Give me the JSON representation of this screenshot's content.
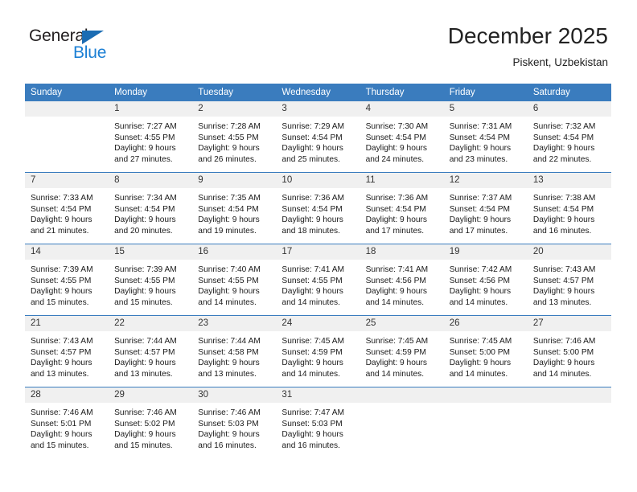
{
  "logo": {
    "primary_text": "General",
    "secondary_text": "Blue",
    "triangle_icon": "triangle-icon",
    "primary_color": "#231f20",
    "secondary_color": "#1b7fd4",
    "triangle_color": "#1b6cb3"
  },
  "header": {
    "title": "December 2025",
    "subtitle": "Piskent, Uzbekistan"
  },
  "theme": {
    "header_bg": "#3a7cbe",
    "header_text": "#ffffff",
    "daynum_bg": "#f0f0f0",
    "row_divider": "#3a7cbe",
    "body_bg": "#ffffff"
  },
  "calendar": {
    "columns": [
      "Sunday",
      "Monday",
      "Tuesday",
      "Wednesday",
      "Thursday",
      "Friday",
      "Saturday"
    ],
    "weeks": [
      [
        {
          "day": "",
          "empty": true,
          "sunrise": "",
          "sunset": "",
          "daylight_line1": "",
          "daylight_line2": ""
        },
        {
          "day": "1",
          "sunrise": "Sunrise: 7:27 AM",
          "sunset": "Sunset: 4:55 PM",
          "daylight_line1": "Daylight: 9 hours",
          "daylight_line2": "and 27 minutes."
        },
        {
          "day": "2",
          "sunrise": "Sunrise: 7:28 AM",
          "sunset": "Sunset: 4:55 PM",
          "daylight_line1": "Daylight: 9 hours",
          "daylight_line2": "and 26 minutes."
        },
        {
          "day": "3",
          "sunrise": "Sunrise: 7:29 AM",
          "sunset": "Sunset: 4:54 PM",
          "daylight_line1": "Daylight: 9 hours",
          "daylight_line2": "and 25 minutes."
        },
        {
          "day": "4",
          "sunrise": "Sunrise: 7:30 AM",
          "sunset": "Sunset: 4:54 PM",
          "daylight_line1": "Daylight: 9 hours",
          "daylight_line2": "and 24 minutes."
        },
        {
          "day": "5",
          "sunrise": "Sunrise: 7:31 AM",
          "sunset": "Sunset: 4:54 PM",
          "daylight_line1": "Daylight: 9 hours",
          "daylight_line2": "and 23 minutes."
        },
        {
          "day": "6",
          "sunrise": "Sunrise: 7:32 AM",
          "sunset": "Sunset: 4:54 PM",
          "daylight_line1": "Daylight: 9 hours",
          "daylight_line2": "and 22 minutes."
        }
      ],
      [
        {
          "day": "7",
          "sunrise": "Sunrise: 7:33 AM",
          "sunset": "Sunset: 4:54 PM",
          "daylight_line1": "Daylight: 9 hours",
          "daylight_line2": "and 21 minutes."
        },
        {
          "day": "8",
          "sunrise": "Sunrise: 7:34 AM",
          "sunset": "Sunset: 4:54 PM",
          "daylight_line1": "Daylight: 9 hours",
          "daylight_line2": "and 20 minutes."
        },
        {
          "day": "9",
          "sunrise": "Sunrise: 7:35 AM",
          "sunset": "Sunset: 4:54 PM",
          "daylight_line1": "Daylight: 9 hours",
          "daylight_line2": "and 19 minutes."
        },
        {
          "day": "10",
          "sunrise": "Sunrise: 7:36 AM",
          "sunset": "Sunset: 4:54 PM",
          "daylight_line1": "Daylight: 9 hours",
          "daylight_line2": "and 18 minutes."
        },
        {
          "day": "11",
          "sunrise": "Sunrise: 7:36 AM",
          "sunset": "Sunset: 4:54 PM",
          "daylight_line1": "Daylight: 9 hours",
          "daylight_line2": "and 17 minutes."
        },
        {
          "day": "12",
          "sunrise": "Sunrise: 7:37 AM",
          "sunset": "Sunset: 4:54 PM",
          "daylight_line1": "Daylight: 9 hours",
          "daylight_line2": "and 17 minutes."
        },
        {
          "day": "13",
          "sunrise": "Sunrise: 7:38 AM",
          "sunset": "Sunset: 4:54 PM",
          "daylight_line1": "Daylight: 9 hours",
          "daylight_line2": "and 16 minutes."
        }
      ],
      [
        {
          "day": "14",
          "sunrise": "Sunrise: 7:39 AM",
          "sunset": "Sunset: 4:55 PM",
          "daylight_line1": "Daylight: 9 hours",
          "daylight_line2": "and 15 minutes."
        },
        {
          "day": "15",
          "sunrise": "Sunrise: 7:39 AM",
          "sunset": "Sunset: 4:55 PM",
          "daylight_line1": "Daylight: 9 hours",
          "daylight_line2": "and 15 minutes."
        },
        {
          "day": "16",
          "sunrise": "Sunrise: 7:40 AM",
          "sunset": "Sunset: 4:55 PM",
          "daylight_line1": "Daylight: 9 hours",
          "daylight_line2": "and 14 minutes."
        },
        {
          "day": "17",
          "sunrise": "Sunrise: 7:41 AM",
          "sunset": "Sunset: 4:55 PM",
          "daylight_line1": "Daylight: 9 hours",
          "daylight_line2": "and 14 minutes."
        },
        {
          "day": "18",
          "sunrise": "Sunrise: 7:41 AM",
          "sunset": "Sunset: 4:56 PM",
          "daylight_line1": "Daylight: 9 hours",
          "daylight_line2": "and 14 minutes."
        },
        {
          "day": "19",
          "sunrise": "Sunrise: 7:42 AM",
          "sunset": "Sunset: 4:56 PM",
          "daylight_line1": "Daylight: 9 hours",
          "daylight_line2": "and 14 minutes."
        },
        {
          "day": "20",
          "sunrise": "Sunrise: 7:43 AM",
          "sunset": "Sunset: 4:57 PM",
          "daylight_line1": "Daylight: 9 hours",
          "daylight_line2": "and 13 minutes."
        }
      ],
      [
        {
          "day": "21",
          "sunrise": "Sunrise: 7:43 AM",
          "sunset": "Sunset: 4:57 PM",
          "daylight_line1": "Daylight: 9 hours",
          "daylight_line2": "and 13 minutes."
        },
        {
          "day": "22",
          "sunrise": "Sunrise: 7:44 AM",
          "sunset": "Sunset: 4:57 PM",
          "daylight_line1": "Daylight: 9 hours",
          "daylight_line2": "and 13 minutes."
        },
        {
          "day": "23",
          "sunrise": "Sunrise: 7:44 AM",
          "sunset": "Sunset: 4:58 PM",
          "daylight_line1": "Daylight: 9 hours",
          "daylight_line2": "and 13 minutes."
        },
        {
          "day": "24",
          "sunrise": "Sunrise: 7:45 AM",
          "sunset": "Sunset: 4:59 PM",
          "daylight_line1": "Daylight: 9 hours",
          "daylight_line2": "and 14 minutes."
        },
        {
          "day": "25",
          "sunrise": "Sunrise: 7:45 AM",
          "sunset": "Sunset: 4:59 PM",
          "daylight_line1": "Daylight: 9 hours",
          "daylight_line2": "and 14 minutes."
        },
        {
          "day": "26",
          "sunrise": "Sunrise: 7:45 AM",
          "sunset": "Sunset: 5:00 PM",
          "daylight_line1": "Daylight: 9 hours",
          "daylight_line2": "and 14 minutes."
        },
        {
          "day": "27",
          "sunrise": "Sunrise: 7:46 AM",
          "sunset": "Sunset: 5:00 PM",
          "daylight_line1": "Daylight: 9 hours",
          "daylight_line2": "and 14 minutes."
        }
      ],
      [
        {
          "day": "28",
          "sunrise": "Sunrise: 7:46 AM",
          "sunset": "Sunset: 5:01 PM",
          "daylight_line1": "Daylight: 9 hours",
          "daylight_line2": "and 15 minutes."
        },
        {
          "day": "29",
          "sunrise": "Sunrise: 7:46 AM",
          "sunset": "Sunset: 5:02 PM",
          "daylight_line1": "Daylight: 9 hours",
          "daylight_line2": "and 15 minutes."
        },
        {
          "day": "30",
          "sunrise": "Sunrise: 7:46 AM",
          "sunset": "Sunset: 5:03 PM",
          "daylight_line1": "Daylight: 9 hours",
          "daylight_line2": "and 16 minutes."
        },
        {
          "day": "31",
          "sunrise": "Sunrise: 7:47 AM",
          "sunset": "Sunset: 5:03 PM",
          "daylight_line1": "Daylight: 9 hours",
          "daylight_line2": "and 16 minutes."
        },
        {
          "day": "",
          "empty": true,
          "sunrise": "",
          "sunset": "",
          "daylight_line1": "",
          "daylight_line2": ""
        },
        {
          "day": "",
          "empty": true,
          "sunrise": "",
          "sunset": "",
          "daylight_line1": "",
          "daylight_line2": ""
        },
        {
          "day": "",
          "empty": true,
          "sunrise": "",
          "sunset": "",
          "daylight_line1": "",
          "daylight_line2": ""
        }
      ]
    ]
  }
}
